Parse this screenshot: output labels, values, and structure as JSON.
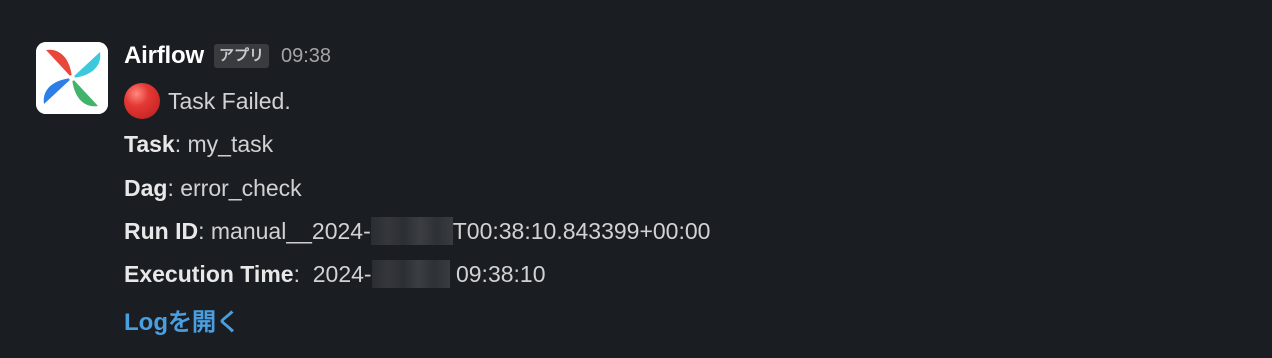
{
  "message": {
    "sender": "Airflow",
    "app_badge": "アプリ",
    "timestamp": "09:38",
    "status_icon": "red-circle",
    "status_text": "Task Failed.",
    "task": {
      "label": "Task",
      "value": "my_task"
    },
    "dag": {
      "label": "Dag",
      "value": "error_check"
    },
    "run_id": {
      "label": "Run ID",
      "prefix": "manual__2024-",
      "suffix": "T00:38:10.843399+00:00"
    },
    "execution_time": {
      "label": "Execution Time",
      "prefix": "2024-",
      "suffix": "09:38:10"
    },
    "link_label": "Logを開く",
    "colors": {
      "background": "#1a1d21",
      "link": "#4a9fe0",
      "status_red": "#e53935"
    }
  }
}
